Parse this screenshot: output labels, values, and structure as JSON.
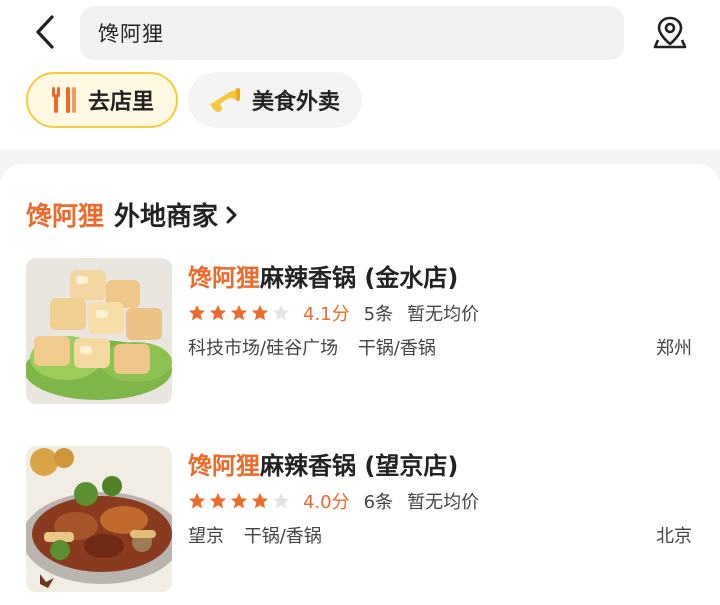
{
  "header": {
    "search_text": "馋阿狸",
    "chips": [
      {
        "label": "去店里",
        "icon": "fork-knife-icon",
        "active": true
      },
      {
        "label": "美食外卖",
        "icon": "delivery-horn-icon",
        "active": false
      }
    ]
  },
  "section": {
    "keyword": "馋阿狸",
    "title": "外地商家"
  },
  "stores": [
    {
      "name_highlight": "馋阿狸",
      "name_rest": "麻辣香锅 (金水店)",
      "stars": 4,
      "score": "4.1分",
      "reviews": "5条",
      "avg_price": "暂无均价",
      "area": "科技市场/硅谷广场",
      "category": "干锅/香锅",
      "city": "郑州"
    },
    {
      "name_highlight": "馋阿狸",
      "name_rest": "麻辣香锅 (望京店)",
      "stars": 4,
      "score": "4.0分",
      "reviews": "6条",
      "avg_price": "暂无均价",
      "area": "望京",
      "category": "干锅/香锅",
      "city": "北京"
    }
  ],
  "colors": {
    "accent": "#ee6a2a",
    "chip_active_bg": "#fff8e3",
    "chip_active_border": "#f5cd3c"
  }
}
